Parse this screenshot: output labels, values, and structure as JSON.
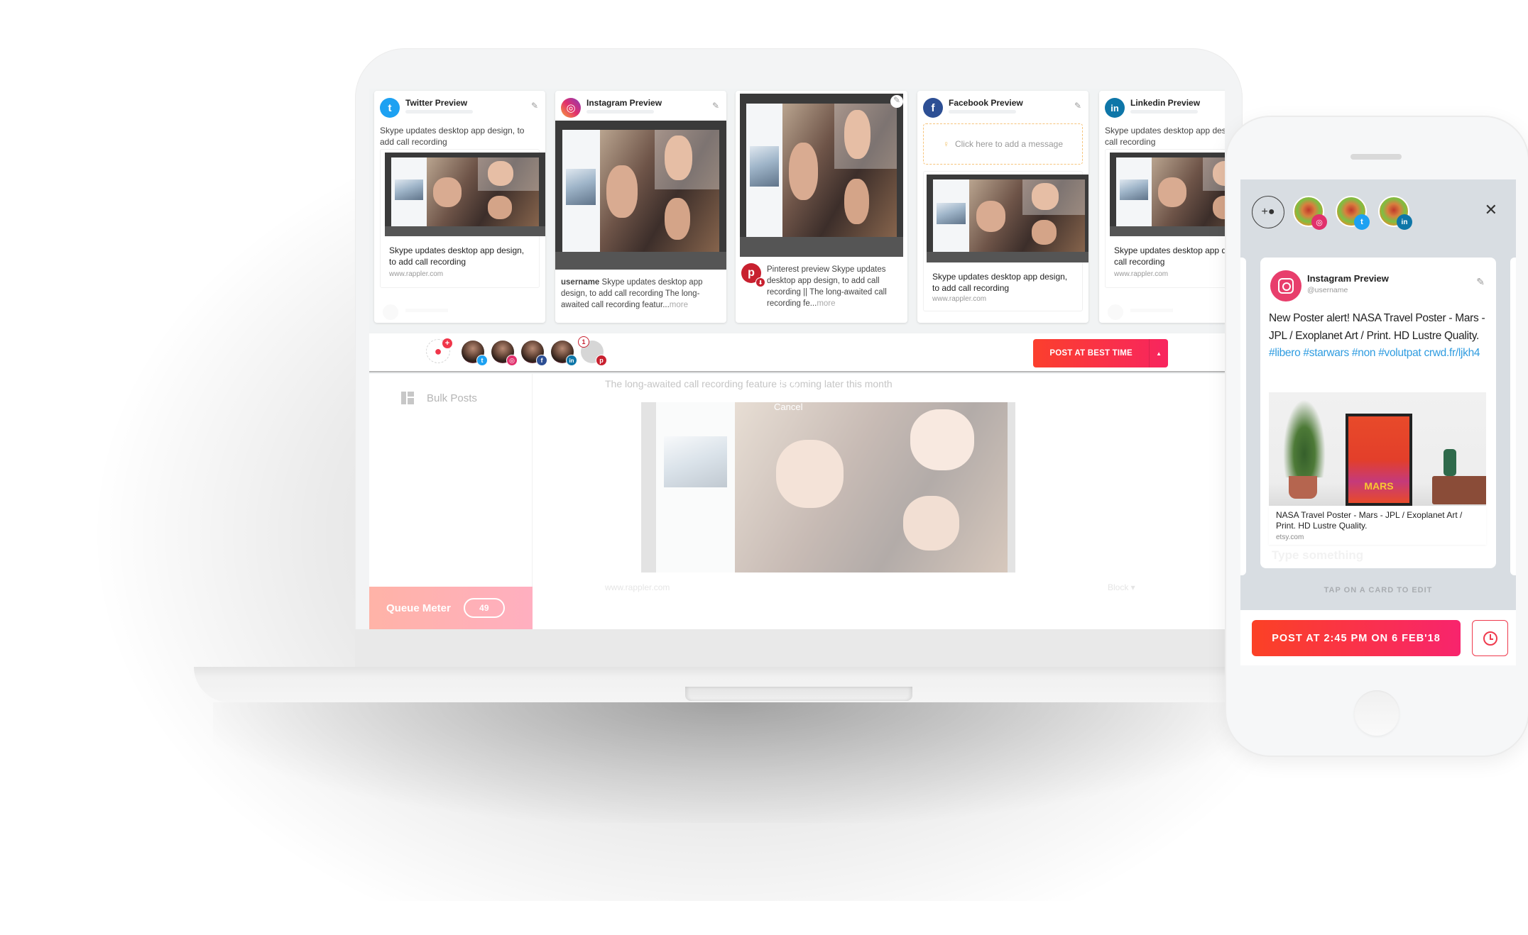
{
  "cards": [
    {
      "network": "twitter",
      "title": "Twitter Preview",
      "text": "Skype updates desktop app design, to add call recording",
      "link_title": "Skype updates desktop app design, to add call recording",
      "link_url": "www.rappler.com",
      "icon": "twitter-icon",
      "color": "#1da1f2"
    },
    {
      "network": "instagram",
      "title": "Instagram Preview",
      "caption_user": "username",
      "caption": "Skype updates desktop app design, to add call recording The long-awaited call recording featur...",
      "more": "more",
      "icon": "instagram-icon",
      "color": "#e1306c"
    },
    {
      "network": "pinterest",
      "caption_user": "Pinterest preview",
      "caption": "Skype updates desktop app design, to add call recording || The long-awaited call recording fe...",
      "more": "more",
      "icon": "pinterest-icon",
      "color": "#c8202f"
    },
    {
      "network": "facebook",
      "title": "Facebook Preview",
      "message_placeholder": "Click here to add a message",
      "link_title": "Skype updates desktop app design, to add call recording",
      "link_url": "www.rappler.com",
      "icon": "facebook-icon",
      "color": "#2d4f94"
    },
    {
      "network": "linkedin",
      "title": "Linkedin Preview",
      "text": "Skype updates desktop app design, to add call recording",
      "link_title": "Skype updates desktop app design, to add call recording",
      "link_url": "www.rappler.com",
      "icon": "linkedin-icon",
      "color": "#0e76a8"
    }
  ],
  "toolbar": {
    "accounts": [
      {
        "network": "twitter",
        "badge_glyph": "t",
        "color": "#1da1f2"
      },
      {
        "network": "instagram",
        "badge_glyph": "◎",
        "color": "#e1306c"
      },
      {
        "network": "facebook",
        "badge_glyph": "f",
        "color": "#2d4f94"
      },
      {
        "network": "linkedin",
        "badge_glyph": "in",
        "color": "#0e76a8"
      },
      {
        "network": "pinterest",
        "badge_glyph": "p",
        "color": "#c8202f",
        "count": "1"
      }
    ],
    "post_button": "POST AT BEST TIME",
    "dropdown_glyph": "▲"
  },
  "editor": {
    "sidebar_item": "Bulk Posts",
    "queue_label": "Queue Meter",
    "queue_count": "49",
    "description": "The long-awaited call recording feature is coming later this month",
    "cancel_label": "Cancel",
    "source_url": "www.rappler.com",
    "block_label": "Block ▾"
  },
  "phone": {
    "accounts": [
      {
        "network": "instagram",
        "badge_glyph": "◎",
        "color": "#e1306c"
      },
      {
        "network": "twitter",
        "badge_glyph": "t",
        "color": "#1da1f2"
      },
      {
        "network": "linkedin",
        "badge_glyph": "in",
        "color": "#0e76a8"
      }
    ],
    "card": {
      "title": "Instagram Preview",
      "username": "@username",
      "text_plain": "New Poster alert! NASA Travel Poster - Mars - JPL / Exoplanet Art  / Print. HD Lustre Quality.",
      "hashtags": "#libero #starwars #non #volutpat",
      "short_link": "crwd.fr/ljkh4",
      "poster_text": "MARS",
      "link_title": "NASA Travel Poster - Mars - JPL / Exoplanet Art  / Print. HD Lustre Quality.",
      "link_url": "etsy.com",
      "input_placeholder": "Type something"
    },
    "hint": "TAP ON A CARD TO EDIT",
    "post_button": "POST AT 2:45 PM ON 6 FEB'18",
    "close_glyph": "✕"
  },
  "colors": {
    "accent_start": "#fb3f2d",
    "accent_end": "#f8255f",
    "hashtag": "#2f9ce0",
    "queue_meter": "#ffb3a7"
  }
}
